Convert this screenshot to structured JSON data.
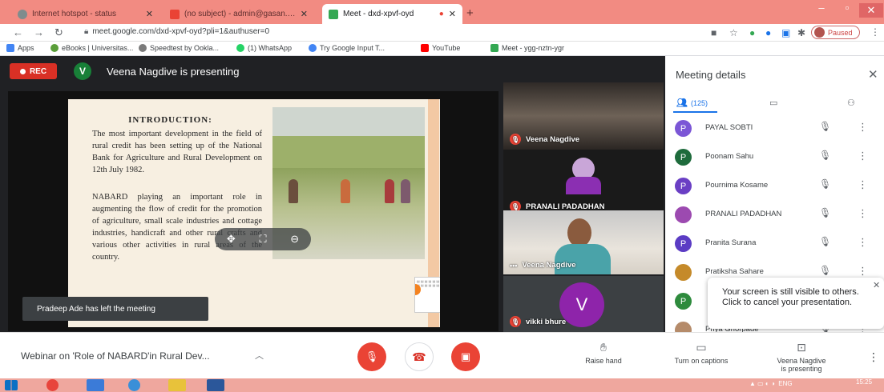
{
  "browser": {
    "tabs": [
      {
        "title": "Internet hotspot - status",
        "icon_color": "#7f8c8d",
        "active": false
      },
      {
        "title": "(no subject) - admin@gasan.org",
        "icon_color": "#ea4335",
        "active": false
      },
      {
        "title": "Meet - dxd-xpvf-oyd",
        "icon_color": "#34a853",
        "active": true
      }
    ],
    "url": "meet.google.com/dxd-xpvf-oyd?pli=1&authuser=0",
    "profile_status": "Paused",
    "bookmarks": [
      {
        "label": "Apps",
        "icon_color": "#4285f4"
      },
      {
        "label": "eBooks | Universitas...",
        "icon_color": "#5a9e3a"
      },
      {
        "label": "Speedtest by Ookla...",
        "icon_color": "#7b7b7b"
      },
      {
        "label": "(1) WhatsApp",
        "icon_color": "#25d366"
      },
      {
        "label": "Try Google Input T...",
        "icon_color": "#4285f4"
      },
      {
        "label": "YouTube",
        "icon_color": "#ff0000"
      },
      {
        "label": "Meet - ygg-nztn-ygr",
        "icon_color": "#34a853"
      }
    ]
  },
  "meet": {
    "rec_label": "REC",
    "presenter_initial": "V",
    "presenting_text": "Veena Nagdive is presenting",
    "slide": {
      "title": "INTRODUCTION:",
      "para1": "The most important development in the field of rural credit has been setting up of the National Bank for Agriculture and Rural Development on 12th July 1982.",
      "para2": "NABARD playing an important role in augmenting the flow of credit for the promotion of agriculture, small scale industries and cottage industries, handicraft and other rural crafts and various other activities in rural areas of the country."
    },
    "left_toast": "Pradeep Ade has left the meeting",
    "tiles": [
      {
        "name": "Veena Nagdive"
      },
      {
        "name": "PRANALI PADADHAN"
      },
      {
        "name": "Veena Nagdive"
      },
      {
        "name": "vikki bhure",
        "initial": "V"
      }
    ],
    "meeting_title": "Webinar on 'Role of NABARD'in Rural Dev...",
    "raise_hand": "Raise hand",
    "captions": "Turn on captions",
    "presenting_ctrl_line1": "Veena Nagdive",
    "presenting_ctrl_line2": "is presenting"
  },
  "panel": {
    "title": "Meeting details",
    "people_count": "(125)",
    "participants": [
      {
        "name": "PAYAL SOBTI",
        "initial": "P",
        "color": "#7b56d6"
      },
      {
        "name": "Poonam Sahu",
        "initial": "P",
        "color": "#1e6b3c"
      },
      {
        "name": "Pournima Kosame",
        "initial": "P",
        "color": "#6a3fc4"
      },
      {
        "name": "PRANALI PADADHAN",
        "initial": "",
        "color": "#9c4ab0"
      },
      {
        "name": "Pranita Surana",
        "initial": "P",
        "color": "#5b3cc4"
      },
      {
        "name": "Pratiksha Sahare",
        "initial": "",
        "color": "#c58a2a"
      },
      {
        "name": "",
        "initial": "P",
        "color": "#2e8b3d"
      },
      {
        "name": "Priya Ghorpade",
        "initial": "",
        "color": "#b58b6a"
      }
    ],
    "screen_toast": "Your screen is still visible to others. Click to cancel your presentation."
  },
  "taskbar": {
    "lang": "ENG",
    "time": "15:25"
  },
  "colors": {
    "accent_blue": "#1a73e8",
    "meet_red": "#ea4335",
    "tab_strip": "#f28b82"
  }
}
